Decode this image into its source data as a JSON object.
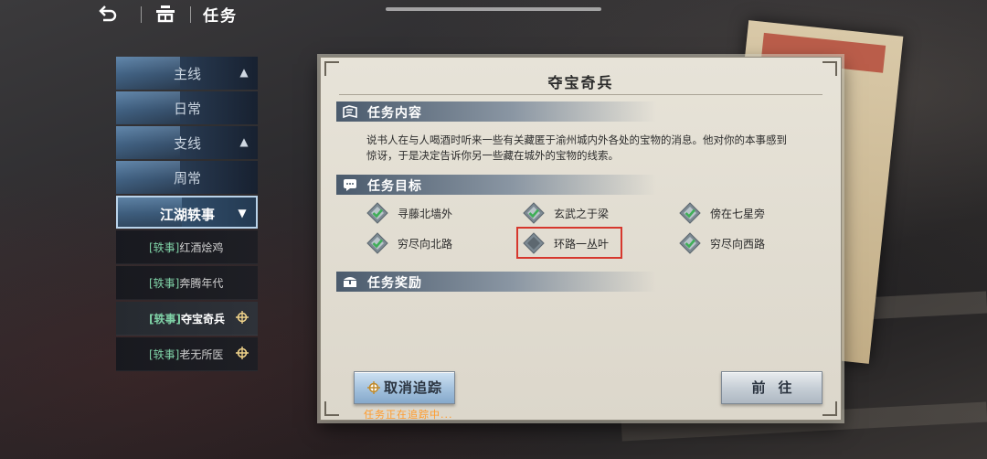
{
  "topbar": {
    "title": "任务",
    "back_icon": "back-arrow-icon",
    "home_icon": "home-icon"
  },
  "sidebar": {
    "categories": [
      {
        "label": "主线",
        "expanded": true
      },
      {
        "label": "日常",
        "expanded": false
      },
      {
        "label": "支线",
        "expanded": true
      },
      {
        "label": "周常",
        "expanded": false
      },
      {
        "label": "江湖轶事",
        "expanded": true
      }
    ],
    "subitems": [
      {
        "tag": "[轶事]",
        "name": "红酒烩鸡",
        "tracking": false
      },
      {
        "tag": "[轶事]",
        "name": "奔腾年代",
        "tracking": false
      },
      {
        "tag": "[轶事]",
        "name": "夺宝奇兵",
        "tracking": true
      },
      {
        "tag": "[轶事]",
        "name": "老无所医",
        "tracking": true
      }
    ]
  },
  "dialog": {
    "title": "夺宝奇兵",
    "sections": {
      "content": "任务内容",
      "goals": "任务目标",
      "rewards": "任务奖励"
    },
    "description": "说书人在与人喝酒时听来一些有关藏匿于渝州城内外各处的宝物的消息。他对你的本事感到惊讶，于是决定告诉你另一些藏在城外的宝物的线索。",
    "objectives": [
      {
        "label": "寻藤北墙外",
        "done": true
      },
      {
        "label": "玄武之于梁",
        "done": true
      },
      {
        "label": "傍在七星旁",
        "done": true
      },
      {
        "label": "穷尽向北路",
        "done": true
      },
      {
        "label": "环路一丛叶",
        "done": false
      },
      {
        "label": "穷尽向西路",
        "done": true
      }
    ],
    "cancel_button": "取消追踪",
    "go_button": "前往",
    "tracking_status": "任务正在追踪中..."
  },
  "colors": {
    "accent_green": "#7fd1a6",
    "highlight_red": "#d6372d",
    "tracking_orange": "#ff9a2a"
  }
}
